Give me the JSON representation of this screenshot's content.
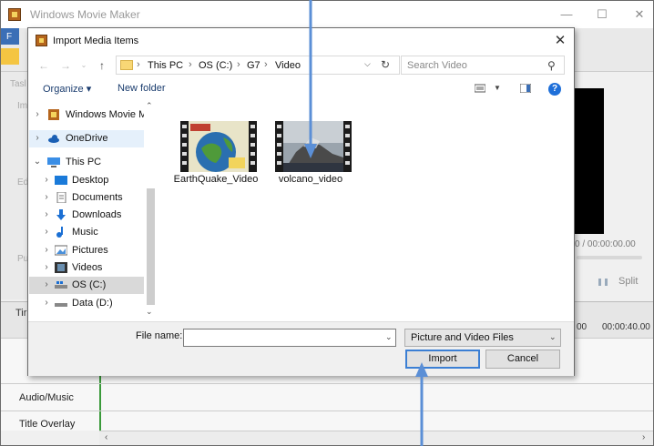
{
  "app": {
    "title": "Windows Movie Maker",
    "side_labels": [
      "Tasl",
      "Im",
      "Ed",
      "Pu"
    ],
    "time_partial": "0 / 00:00:00.00",
    "split_label": "Split",
    "timeline_label": "Tir",
    "timeline_time_a": "00",
    "timeline_time_b": "00:00:40.00",
    "tracks": [
      {
        "label": "Audio/Music"
      },
      {
        "label": "Title Overlay"
      }
    ],
    "toolbar_letter": "F"
  },
  "dialog": {
    "title": "Import Media Items",
    "close_glyph": "✕",
    "breadcrumb": [
      "This PC",
      "OS (C:)",
      "G7",
      "Video"
    ],
    "search_placeholder": "Search Video",
    "organize_label": "Organize ▾",
    "new_folder_label": "New folder",
    "help_glyph": "?",
    "tree": [
      {
        "label": "Windows Movie M",
        "icon": "app-icon",
        "state": ""
      },
      {
        "label": "OneDrive",
        "icon": "cloud-icon",
        "state": "selected"
      },
      {
        "label": "This PC",
        "icon": "computer-icon",
        "state": "expanded"
      },
      {
        "label": "Desktop",
        "icon": "desktop-icon",
        "state": ""
      },
      {
        "label": "Documents",
        "icon": "document-icon",
        "state": ""
      },
      {
        "label": "Downloads",
        "icon": "download-icon",
        "state": ""
      },
      {
        "label": "Music",
        "icon": "music-icon",
        "state": ""
      },
      {
        "label": "Pictures",
        "icon": "pictures-icon",
        "state": ""
      },
      {
        "label": "Videos",
        "icon": "videos-icon",
        "state": ""
      },
      {
        "label": "OS (C:)",
        "icon": "drive-icon",
        "state": "current"
      },
      {
        "label": "Data (D:)",
        "icon": "drive-icon",
        "state": ""
      }
    ],
    "files": [
      {
        "name": "EarthQuake_Video"
      },
      {
        "name": "volcano_video"
      }
    ],
    "file_name_label": "File name:",
    "file_name_value": "",
    "file_type": "Picture and Video Files",
    "import_label": "Import",
    "cancel_label": "Cancel"
  },
  "colors": {
    "accent": "#1e6fd9",
    "arrow": "#5b8fd6",
    "selection": "#e5f0fb",
    "timeline_marker": "#3a9a3a"
  }
}
